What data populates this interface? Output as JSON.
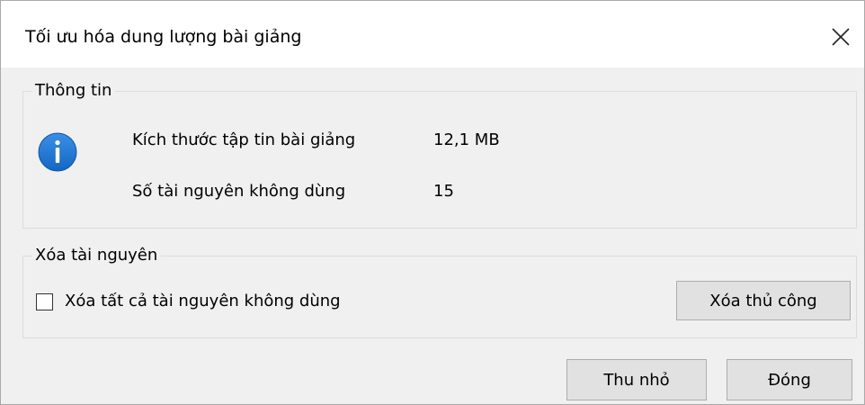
{
  "dialog": {
    "title": "Tối ưu hóa dung lượng bài giảng",
    "close_icon": "close-icon"
  },
  "info_group": {
    "legend": "Thông tin",
    "icon": "info-icon",
    "icon_color": "#1a73d0",
    "rows": [
      {
        "label": "Kích thước tập tin bài giảng",
        "value": "12,1 MB"
      },
      {
        "label": "Số tài nguyên không dùng",
        "value": "15"
      }
    ]
  },
  "delete_group": {
    "legend": "Xóa tài nguyên",
    "checkbox_label": "Xóa tất cả tài nguyên không dùng",
    "checkbox_checked": false,
    "manual_button": "Xóa thủ công"
  },
  "footer": {
    "shrink_button": "Thu nhỏ",
    "close_button": "Đóng"
  }
}
